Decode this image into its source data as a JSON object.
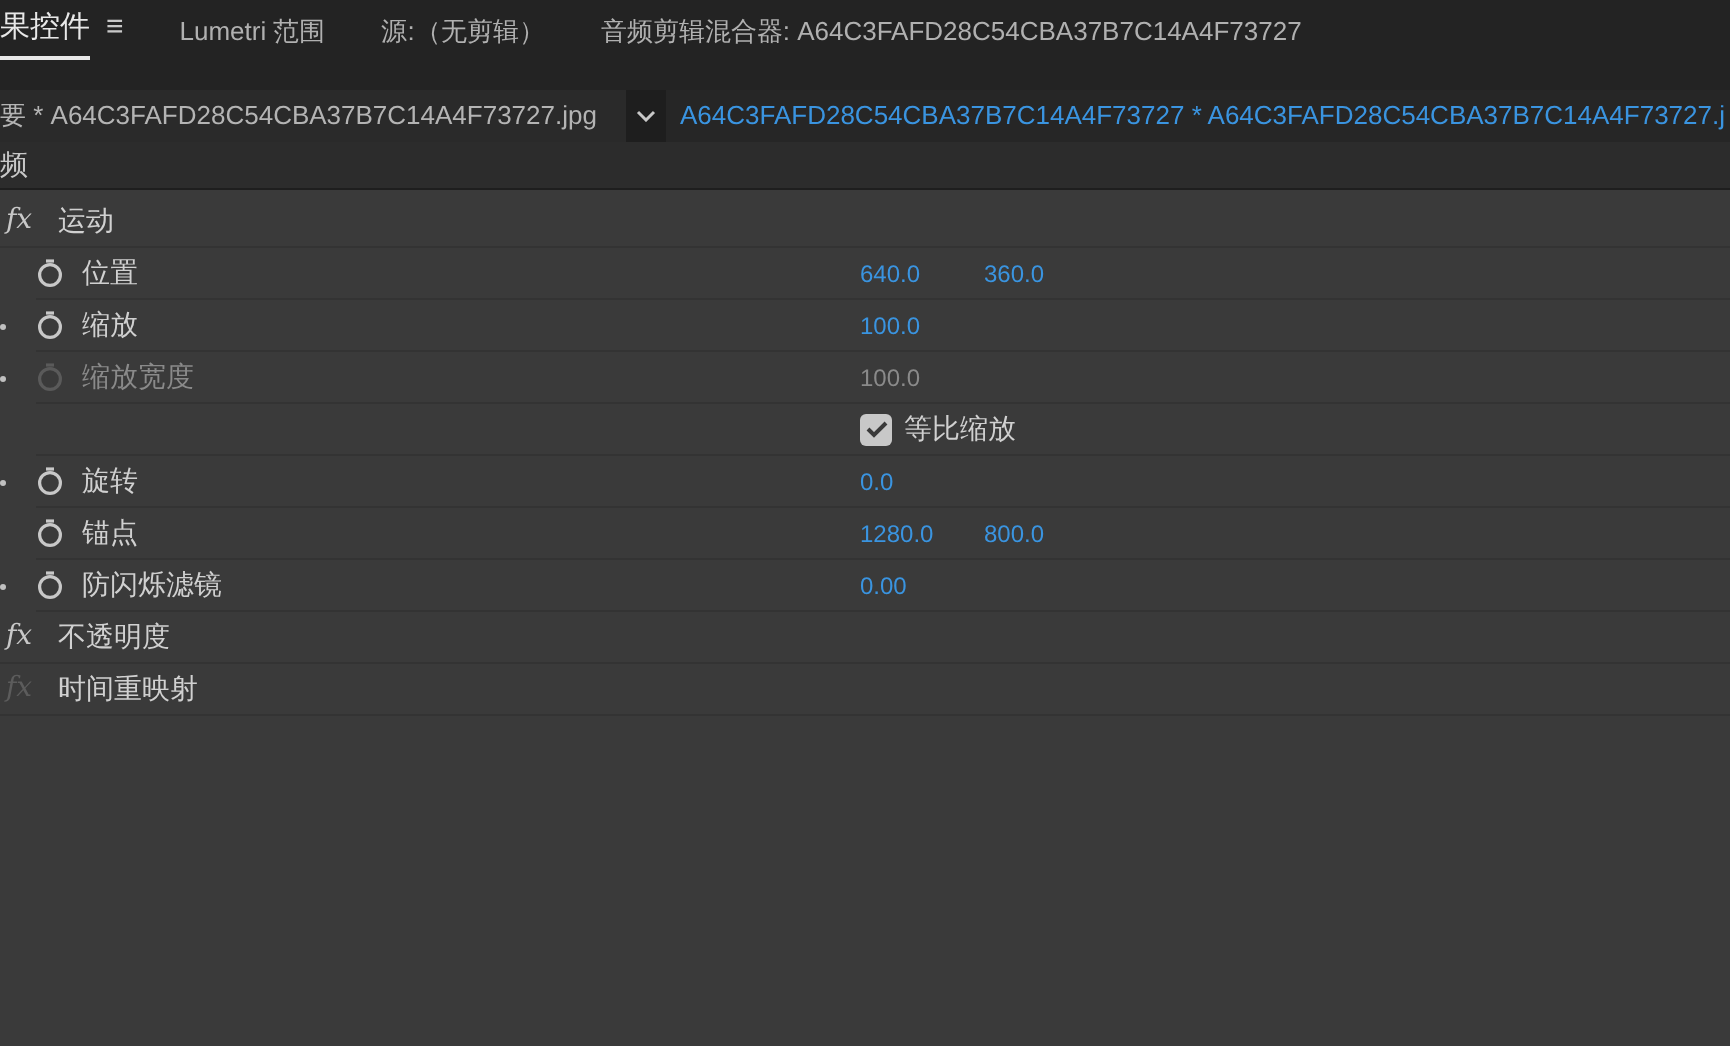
{
  "tabs": [
    {
      "label": "果控件",
      "selected": true,
      "menu": "≡"
    },
    {
      "label": "Lumetri 范围",
      "selected": false
    },
    {
      "label": "源:（无剪辑）",
      "selected": false
    },
    {
      "label": "音频剪辑混合器: A64C3FAFD28C54CBA37B7C14A4F73727",
      "selected": false
    }
  ],
  "source_bar": {
    "master": "要 * A64C3FAFD28C54CBA37B7C14A4F73727.jpg",
    "clip": "A64C3FAFD28C54CBA37B7C14A4F73727 * A64C3FAFD28C54CBA37B7C14A4F73727.j"
  },
  "section": "频",
  "effects": [
    {
      "icon": "fx",
      "name": "运动",
      "enabled": true,
      "properties": [
        {
          "kind": "value",
          "name": "位置",
          "expandable": false,
          "disabled": false,
          "values": [
            "640.0",
            "360.0"
          ]
        },
        {
          "kind": "value",
          "name": "缩放",
          "expandable": true,
          "disabled": false,
          "values": [
            "100.0"
          ]
        },
        {
          "kind": "value",
          "name": "缩放宽度",
          "expandable": true,
          "disabled": true,
          "values": [
            "100.0"
          ]
        },
        {
          "kind": "checkbox",
          "label": "等比缩放",
          "checked": true
        },
        {
          "kind": "value",
          "name": "旋转",
          "expandable": true,
          "disabled": false,
          "values": [
            "0.0"
          ]
        },
        {
          "kind": "value",
          "name": "锚点",
          "expandable": false,
          "disabled": false,
          "values": [
            "1280.0",
            "800.0"
          ]
        },
        {
          "kind": "value",
          "name": "防闪烁滤镜",
          "expandable": true,
          "disabled": false,
          "values": [
            "0.00"
          ]
        }
      ]
    },
    {
      "icon": "fx",
      "name": "不透明度",
      "enabled": true
    },
    {
      "icon": "fx",
      "name": "时间重映射",
      "enabled": false
    }
  ]
}
